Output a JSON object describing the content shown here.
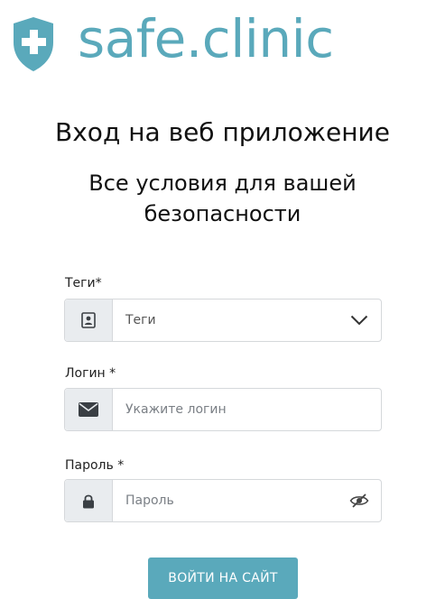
{
  "brand": {
    "name": "safe.clinic",
    "logo_icon": "shield-plus-icon",
    "color": "#5aa9bb"
  },
  "page": {
    "title": "Вход на веб приложение",
    "subtitle": "Все условия для вашей безопасности"
  },
  "form": {
    "tags": {
      "label": "Теги*",
      "value": "Теги",
      "icon": "id-card-icon",
      "trailing_icon": "chevron-down-icon"
    },
    "login": {
      "label": "Логин *",
      "placeholder": "Укажите логин",
      "value": "",
      "icon": "envelope-icon"
    },
    "password": {
      "label": "Пароль *",
      "placeholder": "Пароль",
      "value": "",
      "icon": "lock-icon",
      "trailing_icon": "eye-slash-icon"
    },
    "submit_label": "ВОЙТИ НА САЙТ"
  },
  "colors": {
    "accent": "#5aa9bb",
    "addon_bg": "#e9ecef",
    "border": "#d5d8db"
  }
}
